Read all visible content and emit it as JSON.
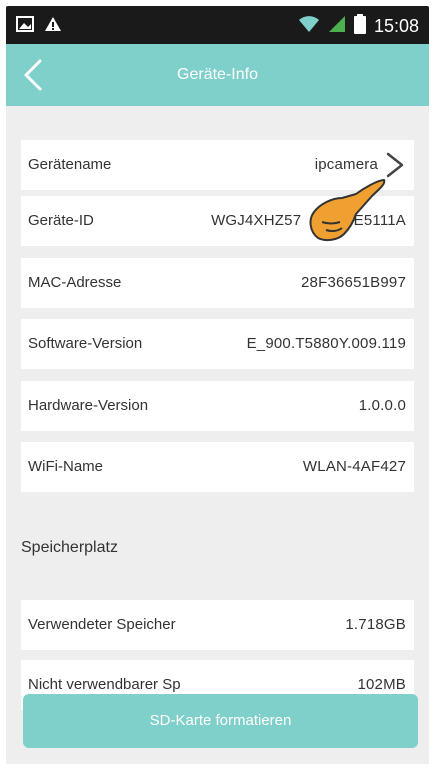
{
  "status_bar": {
    "time": "15:08",
    "icons": [
      "image-icon",
      "warning-icon",
      "wifi-icon",
      "signal-icon",
      "battery-icon"
    ]
  },
  "header": {
    "title": "Geräte-Info",
    "back_icon": "chevron-left-icon",
    "color": "#7fcfcb"
  },
  "device_info": [
    {
      "label": "Gerätename",
      "value": "ipcamera"
    },
    {
      "label": "Geräte-ID",
      "value": "WGJ4XHZ57            E5111A"
    },
    {
      "label": "MAC-Adresse",
      "value": "28F36651B997"
    },
    {
      "label": "Software-Version",
      "value": "E_900.T5880Y.009.119"
    },
    {
      "label": "Hardware-Version",
      "value": "1.0.0.0"
    },
    {
      "label": "WiFi-Name",
      "value": "WLAN-4AF427"
    }
  ],
  "storage": {
    "title": "Speicherplatz",
    "items": [
      {
        "label": "Verwendeter Speicher",
        "value": "1.718GB"
      },
      {
        "label": "Nicht verwendbarer Sp",
        "value": "102MB"
      }
    ]
  },
  "format_button": {
    "label": "SD-Karte formatieren"
  }
}
